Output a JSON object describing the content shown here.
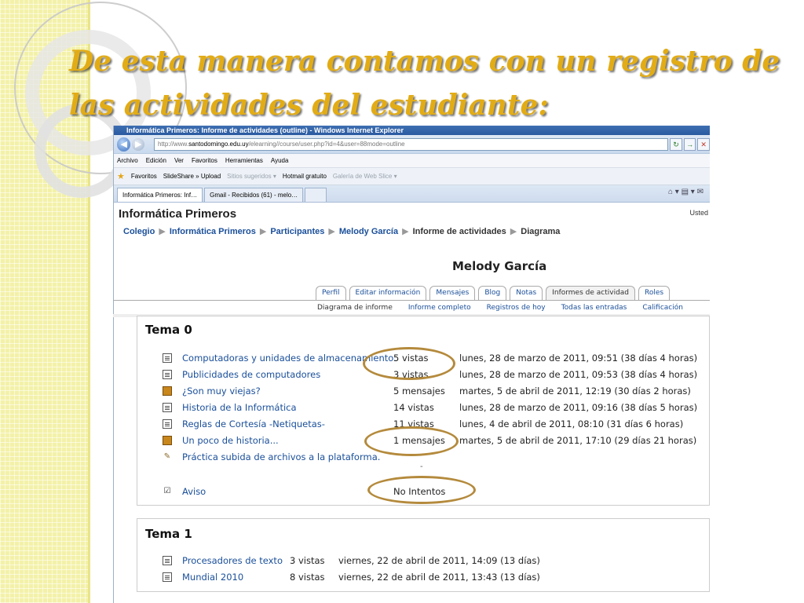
{
  "slide": {
    "title": "De esta manera contamos con un registro de las actividades del estudiante:"
  },
  "browser": {
    "window_title": "Informática Primeros: Informe de actividades (outline) - Windows Internet Explorer",
    "url_prefix": "http://www.",
    "url_domain": "santodomingo.edu.uy",
    "url_path": "/elearning//course/user.php?id=4&user=88mode=outline",
    "menu": [
      "Archivo",
      "Edición",
      "Ver",
      "Favoritos",
      "Herramientas",
      "Ayuda"
    ],
    "favorites": {
      "label": "Favoritos",
      "items": [
        "SlideShare » Upload",
        "Sitios sugeridos ▾",
        "Hotmail gratuito",
        "Galería de Web Slice ▾"
      ]
    },
    "tabs": [
      "Informática Primeros: Inf…",
      "Gmail - Recibidos (61) - melo…"
    ]
  },
  "moodle": {
    "site_name": "Informática Primeros",
    "login_info": "Usted",
    "breadcrumb": [
      "Colegio",
      "Informática Primeros",
      "Participantes",
      "Melody García"
    ],
    "breadcrumb_current": "Informe de actividades",
    "breadcrumb_last": "Diagrama",
    "user_name": "Melody García",
    "tabs": [
      "Perfil",
      "Editar información",
      "Mensajes",
      "Blog",
      "Notas",
      "Informes de actividad",
      "Roles"
    ],
    "subtabs": [
      "Diagrama de informe",
      "Informe completo",
      "Registros de hoy",
      "Todas las entradas",
      "Calificación"
    ],
    "sections": [
      {
        "title": "Tema 0",
        "rows": [
          {
            "name": "Computadoras y unidades de almacenamiento.",
            "count": "5 vistas",
            "date": "lunes, 28 de marzo de 2011, 09:51 (38 días 4 horas)"
          },
          {
            "name": "Publicidades de computadores",
            "count": "3 vistas",
            "date": "lunes, 28 de marzo de 2011, 09:53 (38 días 4 horas)"
          },
          {
            "name": "¿Son muy viejas?",
            "count": "5 mensajes",
            "date": "martes, 5 de abril de 2011, 12:19 (30 días 2 horas)"
          },
          {
            "name": "Historia de la Informática",
            "count": "14 vistas",
            "date": "lunes, 28 de marzo de 2011, 09:16 (38 días 5 horas)"
          },
          {
            "name": "Reglas de Cortesía -Netiquetas-",
            "count": "11 vistas",
            "date": "lunes, 4 de abril de 2011, 08:10 (31 días 6 horas)"
          },
          {
            "name": "Un poco de historia...",
            "count": "1 mensajes",
            "date": "martes, 5 de abril de 2011, 17:10 (29 días 21 horas)"
          },
          {
            "name": "Práctica subida de archivos a la plataforma.",
            "count": "",
            "date": ""
          },
          {
            "name": "Aviso",
            "count": "No Intentos",
            "date": ""
          }
        ],
        "dash": "-"
      },
      {
        "title": "Tema 1",
        "rows": [
          {
            "name": "Procesadores de texto",
            "count": "3 vistas",
            "date": "viernes, 22 de abril de 2011, 14:09 (13 días)"
          },
          {
            "name": "Mundial 2010",
            "count": "8 vistas",
            "date": "viernes, 22 de abril de 2011, 13:43 (13 días)"
          }
        ]
      }
    ]
  },
  "icons": [
    "back-icon",
    "forward-icon",
    "refresh-icon",
    "stop-icon",
    "star-icon",
    "home-icon",
    "resource-icon",
    "forum-icon",
    "assignment-icon",
    "quiz-icon"
  ],
  "colors": {
    "title": "#e2ac16",
    "link": "#1a4f9a",
    "highlight_oval": "#b48a3c",
    "strip": "#f3f1a8"
  }
}
